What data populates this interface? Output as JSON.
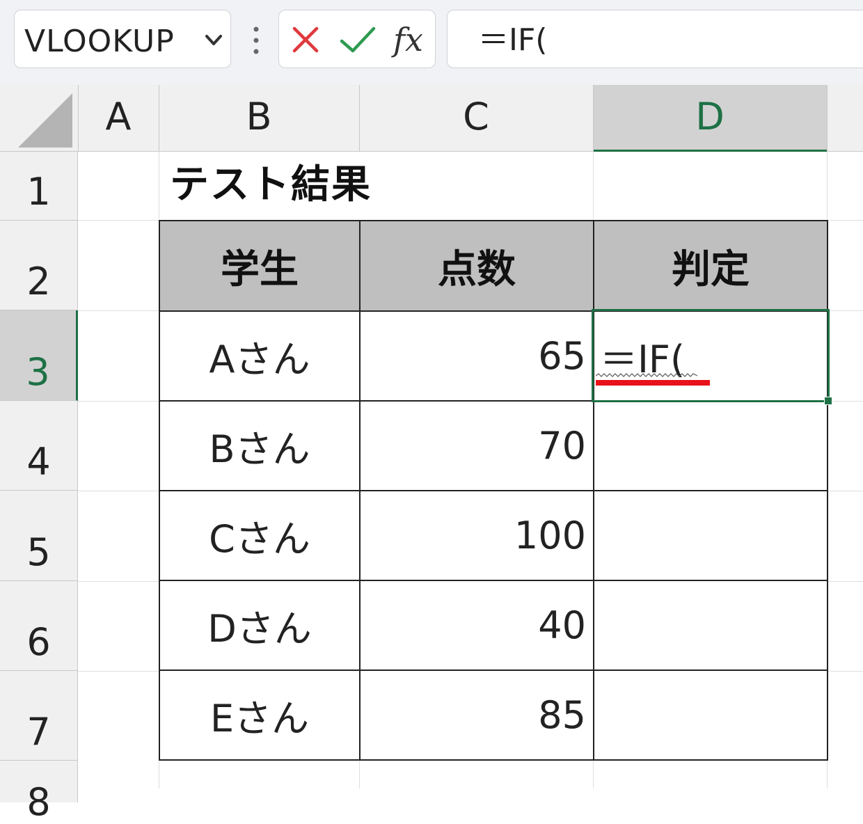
{
  "formula_bar": {
    "name_box": "VLOOKUP",
    "fx_label": "fx",
    "formula": "＝IF(",
    "cancel_icon": "close-icon",
    "enter_icon": "check-icon",
    "colors": {
      "cancel": "#e0393e",
      "enter": "#2e9a4f"
    }
  },
  "columns": [
    "A",
    "B",
    "C",
    "D"
  ],
  "selected_column": "D",
  "rows": [
    "1",
    "2",
    "3",
    "4",
    "5",
    "6",
    "7",
    "8"
  ],
  "selected_row": "3",
  "sheet": {
    "title": "テスト結果",
    "headers": [
      "学生",
      "点数",
      "判定"
    ],
    "records": [
      {
        "name": "Aさん",
        "score": "65",
        "judge": "＝IF("
      },
      {
        "name": "Bさん",
        "score": "70",
        "judge": ""
      },
      {
        "name": "Cさん",
        "score": "100",
        "judge": ""
      },
      {
        "name": "Dさん",
        "score": "40",
        "judge": ""
      },
      {
        "name": "Eさん",
        "score": "85",
        "judge": ""
      }
    ]
  },
  "colors": {
    "accent": "#1e7145",
    "header_fill": "#bfbfbf",
    "annotation": "#e8121a"
  }
}
